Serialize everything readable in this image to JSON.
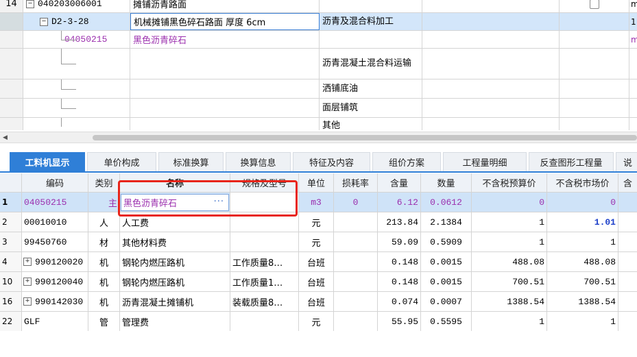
{
  "top_rows": [
    {
      "num": "14",
      "code": "040203006001",
      "name": "摊铺沥青路面",
      "feature": "",
      "expander": "−",
      "e3": "m"
    },
    {
      "num": "",
      "code": "D2-3-28",
      "name": "机械摊铺黑色碎石路面 厚度 6cm",
      "feature": "沥青及混合料加工",
      "expander": "−",
      "e3": "1"
    },
    {
      "num": "",
      "code": "04050215",
      "name": "黑色沥青碎石",
      "feature": "",
      "e3": "m"
    },
    {
      "num": "",
      "code": "",
      "name": "",
      "feature": "沥青混凝土混合料运输",
      "e3": ""
    },
    {
      "num": "",
      "code": "",
      "name": "",
      "feature": "洒铺底油",
      "e3": ""
    },
    {
      "num": "",
      "code": "",
      "name": "",
      "feature": "面层铺筑",
      "e3": ""
    },
    {
      "num": "",
      "code": "",
      "name": "",
      "feature": "其他",
      "e3": ""
    }
  ],
  "tabs": [
    "工料机显示",
    "单价构成",
    "标准换算",
    "换算信息",
    "特征及内容",
    "组价方案",
    "工程量明细",
    "反查图形工程量",
    "说"
  ],
  "columns": {
    "code": "编码",
    "type": "类别",
    "name": "名称",
    "spec": "规格及型号",
    "unit": "单位",
    "loss": "损耗率",
    "qty": "含量",
    "amount": "数量",
    "budget_price": "不含税预算价",
    "market_price": "不含税市场价",
    "tax": "含"
  },
  "rows": [
    {
      "idx": "1",
      "code": "04050215",
      "type": "主",
      "name": "黑色沥青碎石",
      "spec": "",
      "unit": "m3",
      "loss": "0",
      "qty": "6.12",
      "amount": "0.0612",
      "budget_price": "0",
      "market_price": "0"
    },
    {
      "idx": "2",
      "code": "00010010",
      "type": "人",
      "name": "人工费",
      "spec": "",
      "unit": "元",
      "loss": "",
      "qty": "213.84",
      "amount": "2.1384",
      "budget_price": "1",
      "market_price": "1.01"
    },
    {
      "idx": "3",
      "code": "99450760",
      "type": "材",
      "name": "其他材料费",
      "spec": "",
      "unit": "元",
      "loss": "",
      "qty": "59.09",
      "amount": "0.5909",
      "budget_price": "1",
      "market_price": "1"
    },
    {
      "idx": "4",
      "code": "990120020",
      "type": "机",
      "name": "钢轮内燃压路机",
      "spec": "工作质量8…",
      "unit": "台班",
      "loss": "",
      "qty": "0.148",
      "amount": "0.0015",
      "budget_price": "488.08",
      "market_price": "488.08",
      "expander": "+"
    },
    {
      "idx": "10",
      "code": "990120040",
      "type": "机",
      "name": "钢轮内燃压路机",
      "spec": "工作质量1…",
      "unit": "台班",
      "loss": "",
      "qty": "0.148",
      "amount": "0.0015",
      "budget_price": "700.51",
      "market_price": "700.51",
      "expander": "+"
    },
    {
      "idx": "16",
      "code": "990142030",
      "type": "机",
      "name": "沥青混凝土摊铺机",
      "spec": "装载质量8…",
      "unit": "台班",
      "loss": "",
      "qty": "0.074",
      "amount": "0.0007",
      "budget_price": "1388.54",
      "market_price": "1388.54",
      "expander": "+"
    },
    {
      "idx": "22",
      "code": "GLF",
      "type": "管",
      "name": "管理费",
      "spec": "",
      "unit": "元",
      "loss": "",
      "qty": "55.95",
      "amount": "0.5595",
      "budget_price": "1",
      "market_price": "1"
    }
  ],
  "edit_dots": "···",
  "colors": {
    "accent": "#2f7fd7",
    "selection": "#cfe3f8",
    "purple_text": "#9b2fae",
    "highlight": "#e8241a"
  }
}
